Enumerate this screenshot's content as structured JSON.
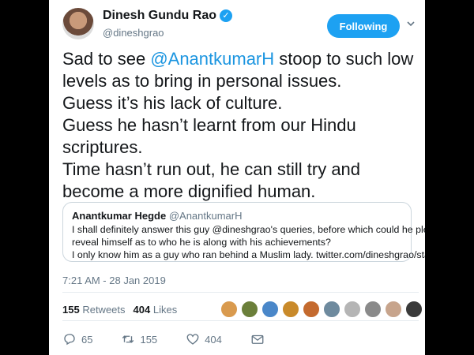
{
  "author": {
    "name": "Dinesh Gundu Rao",
    "handle": "@dineshgrao",
    "verified": true
  },
  "follow_button": {
    "label": "Following"
  },
  "tweet": {
    "text_before_mention": "Sad to see ",
    "mention": "@AnantkumarH",
    "text_after_mention": " stoop to such low",
    "lines": [
      "levels as to bring in personal issues.",
      "Guess it’s his lack of culture.",
      "Guess he hasn’t learnt from our Hindu",
      "scriptures.",
      "Time hasn’t run out, he can still try and",
      "become a more dignified human."
    ]
  },
  "quote": {
    "name": "Anantkumar Hegde",
    "handle": "@AnantkumarH",
    "lines": [
      "I shall definitely answer this guy @dineshgrao's queries, before which could he please",
      "reveal himself as to who he is along with his achievements?",
      "I only know him as a guy who ran behind a Muslim lady. twitter.com/dineshgrao/sta..."
    ]
  },
  "timestamp": "7:21 AM - 28 Jan 2019",
  "stats": {
    "retweets_count": "155",
    "retweets_label": "Retweets",
    "likes_count": "404",
    "likes_label": "Likes"
  },
  "liker_avatar_colors": [
    "#d99a4e",
    "#6b7f3a",
    "#4a87c9",
    "#c98a2a",
    "#c46a2e",
    "#6e8a9e",
    "#b5b5b5",
    "#8a8a8a",
    "#c7a48c",
    "#3a3a3a"
  ],
  "actions": {
    "reply_count": "65",
    "retweet_count": "155",
    "like_count": "404"
  },
  "colors": {
    "accent": "#1da1f2",
    "mention": "#1b95e0",
    "muted": "#657786",
    "text": "#14171a"
  },
  "icons": [
    "verified-badge-icon",
    "chevron-down-icon",
    "reply-icon",
    "retweet-icon",
    "heart-icon",
    "envelope-icon"
  ]
}
